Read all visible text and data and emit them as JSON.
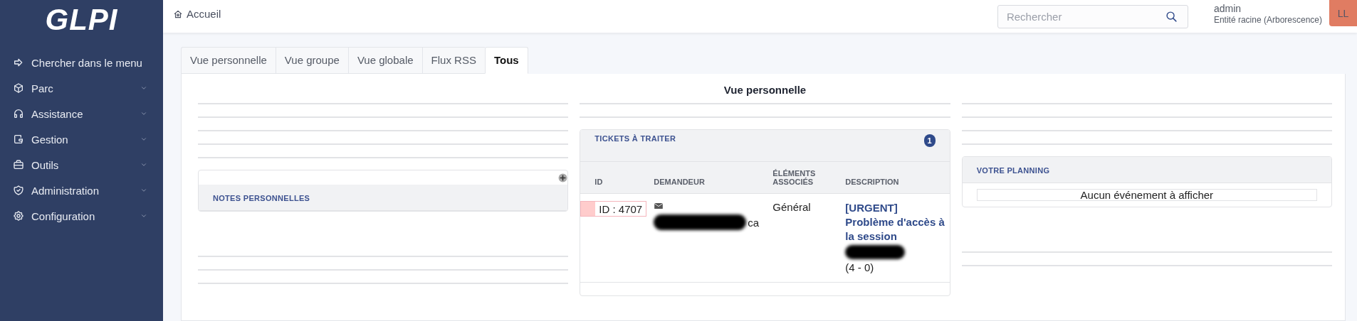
{
  "sidebar": {
    "logo": "GLPI",
    "items": [
      {
        "label": "Chercher dans le menu",
        "expandable": false
      },
      {
        "label": "Parc",
        "expandable": true
      },
      {
        "label": "Assistance",
        "expandable": true
      },
      {
        "label": "Gestion",
        "expandable": true
      },
      {
        "label": "Outils",
        "expandable": true
      },
      {
        "label": "Administration",
        "expandable": true
      },
      {
        "label": "Configuration",
        "expandable": true
      }
    ]
  },
  "breadcrumb": "Accueil",
  "search": {
    "placeholder": "Rechercher"
  },
  "user": {
    "name": "admin",
    "entity": "Entité racine (Arborescence)",
    "initials": "LL"
  },
  "tabs": [
    {
      "label": "Vue personnelle",
      "selected": false
    },
    {
      "label": "Vue groupe",
      "selected": false
    },
    {
      "label": "Vue globale",
      "selected": false
    },
    {
      "label": "Flux RSS",
      "selected": false
    },
    {
      "label": "Tous",
      "selected": true
    }
  ],
  "view_title": "Vue personnelle",
  "notes_panel": {
    "title": "NOTES PERSONNELLES"
  },
  "tickets_panel": {
    "title": "TICKETS À TRAITER",
    "count": "1",
    "columns": [
      "ID",
      "DEMANDEUR",
      "ÉLÉMENTS ASSOCIÉS",
      "DESCRIPTION"
    ],
    "rows": [
      {
        "id": "ID : 4707",
        "color": "#ffcccc",
        "requester": "ca",
        "items": "Général",
        "description": "[URGENT] Problème d'accès à la session",
        "description_suffix": "(4 - 0)"
      }
    ]
  },
  "planning_panel": {
    "title": "VOTRE PLANNING",
    "empty_message": "Aucun événement à afficher"
  }
}
